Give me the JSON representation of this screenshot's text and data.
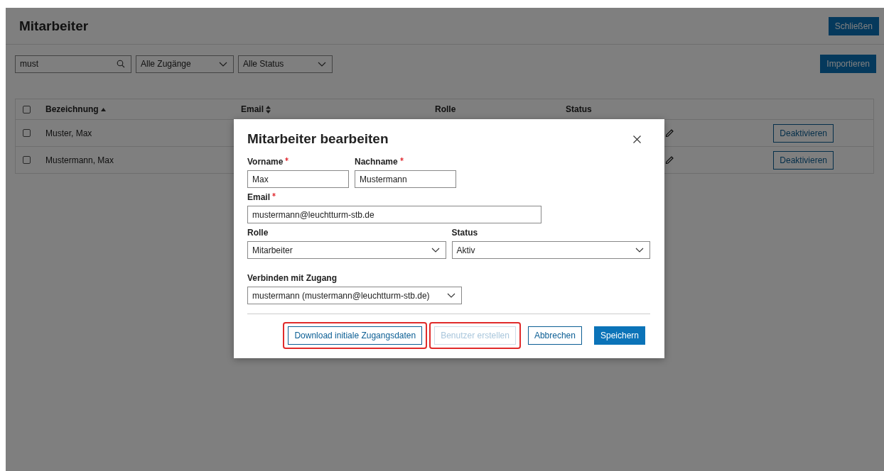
{
  "page": {
    "title": "Mitarbeiter",
    "close_button": "Schließen"
  },
  "filters": {
    "search": {
      "value": "must"
    },
    "selects": [
      {
        "value": "Alle Zugänge"
      },
      {
        "value": "Alle Status"
      }
    ],
    "import_button": "Importieren"
  },
  "table": {
    "select_all_checked": false,
    "columns": [
      {
        "label": "Bezeichnung",
        "sortable": true,
        "sorted": true
      },
      {
        "label": "Email",
        "sortable": true,
        "sorted": false
      },
      {
        "label": "Rolle",
        "sortable": false
      },
      {
        "label": "Status",
        "sortable": false
      }
    ],
    "rows": [
      {
        "name": "Muster, Max",
        "checked": false,
        "action": "Deaktivieren"
      },
      {
        "name": "Mustermann, Max",
        "checked": false,
        "action": "Deaktivieren"
      }
    ]
  },
  "dialog": {
    "title": "Mitarbeiter bearbeiten",
    "field_rows": [
      [
        {
          "kind": "text",
          "label": "Vorname",
          "required": true,
          "value": "Max"
        },
        {
          "kind": "text",
          "label": "Nachname",
          "required": true,
          "value": "Mustermann"
        }
      ],
      [
        {
          "kind": "text",
          "label": "Email",
          "required": true,
          "value": "mustermann@leuchtturm-stb.de"
        }
      ],
      [
        {
          "kind": "select",
          "label": "Rolle",
          "required": false,
          "value": "Mitarbeiter"
        },
        {
          "kind": "select",
          "label": "Status",
          "required": false,
          "value": "Aktiv"
        }
      ],
      [
        {
          "kind": "select",
          "label": "Verbinden mit Zugang",
          "required": false,
          "value": "mustermann (mustermann@leuchtturm-stb.de)"
        }
      ]
    ],
    "buttons": [
      {
        "kind": "outline",
        "label": "Download initiale Zugangsdaten",
        "disabled": false,
        "highlighted": true
      },
      {
        "kind": "outline",
        "label": "Benutzer erstellen",
        "disabled": true,
        "highlighted": true
      },
      {
        "kind": "outline",
        "label": "Abbrechen",
        "disabled": false,
        "highlighted": false
      },
      {
        "kind": "primary",
        "label": "Speichern",
        "disabled": false,
        "highlighted": false
      }
    ]
  }
}
